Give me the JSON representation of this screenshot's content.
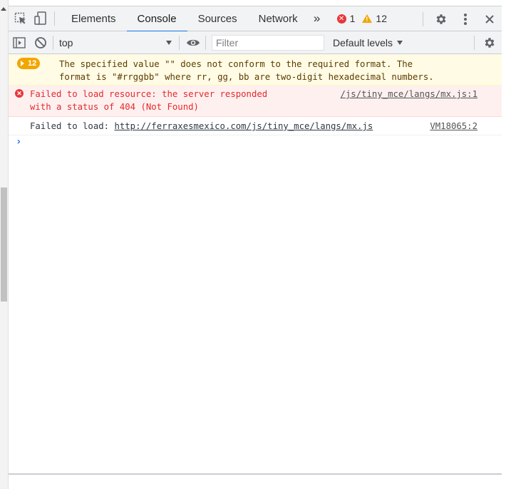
{
  "tabs": [
    {
      "label": "Elements"
    },
    {
      "label": "Console"
    },
    {
      "label": "Sources"
    },
    {
      "label": "Network"
    }
  ],
  "more_tabs_label": "»",
  "counts": {
    "errors": "1",
    "warnings": "12"
  },
  "console_toolbar": {
    "context": "top",
    "filter_placeholder": "Filter",
    "levels": "Default levels"
  },
  "messages": {
    "warning": {
      "badge": "12",
      "line1": "The specified value \"\" does not conform to the required format.  The",
      "line2": "format is \"#rrggbb\" where rr, gg, bb are two-digit hexadecimal numbers."
    },
    "error": {
      "line1": "Failed to load resource: the server responded",
      "line2": "with a status of 404 (Not Found)",
      "source": "/js/tiny_mce/langs/mx.js:1"
    },
    "log": {
      "prefix": "Failed to load: ",
      "url": "http://ferraxesmexico.com/js/tiny_mce/langs/mx.js",
      "source": "VM18065:2"
    }
  },
  "prompt_symbol": "›",
  "colors": {
    "accent": "#1a73e8",
    "error": "#e32a2a",
    "warning": "#f2a600"
  },
  "icons": [
    "inspect-icon",
    "device-toolbar-icon",
    "error-icon",
    "warning-icon",
    "settings-icon",
    "more-vert-icon",
    "close-icon",
    "sidebar-icon",
    "clear-icon",
    "eye-icon"
  ]
}
